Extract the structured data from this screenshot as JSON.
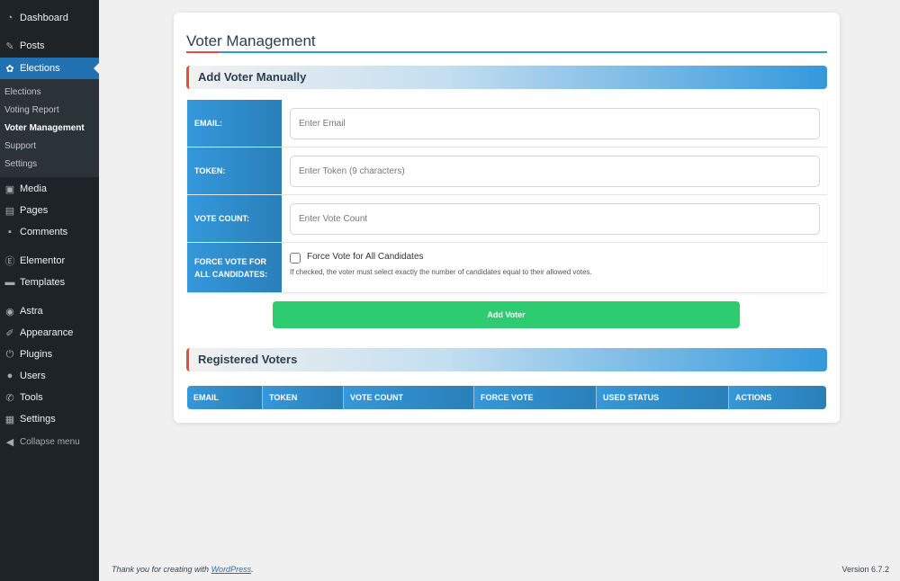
{
  "sidebar": {
    "items": [
      {
        "label": "Dashboard",
        "icon": "dashboard-icon"
      },
      {
        "label": "Posts",
        "icon": "pin-icon"
      },
      {
        "label": "Elections",
        "icon": "group-icon"
      },
      {
        "label": "Media",
        "icon": "media-icon"
      },
      {
        "label": "Pages",
        "icon": "pages-icon"
      },
      {
        "label": "Comments",
        "icon": "comment-icon"
      },
      {
        "label": "Elementor",
        "icon": "elementor-icon"
      },
      {
        "label": "Templates",
        "icon": "folder-icon"
      },
      {
        "label": "Astra",
        "icon": "astra-icon"
      },
      {
        "label": "Appearance",
        "icon": "brush-icon"
      },
      {
        "label": "Plugins",
        "icon": "plug-icon"
      },
      {
        "label": "Users",
        "icon": "user-icon"
      },
      {
        "label": "Tools",
        "icon": "wrench-icon"
      },
      {
        "label": "Settings",
        "icon": "settings-icon"
      }
    ],
    "submenu": [
      "Elections",
      "Voting Report",
      "Voter Management",
      "Support",
      "Settings"
    ],
    "collapse": "Collapse menu"
  },
  "page": {
    "title": "Voter Management"
  },
  "add_section": {
    "title": "Add Voter Manually",
    "email_label": "EMAIL:",
    "email_placeholder": "Enter Email",
    "token_label": "TOKEN:",
    "token_placeholder": "Enter Token (9 characters)",
    "count_label": "VOTE COUNT:",
    "count_placeholder": "Enter Vote Count",
    "force_label": "FORCE VOTE FOR ALL CANDIDATES:",
    "force_checkbox": "Force Vote for All Candidates",
    "force_checked": false,
    "force_hint": "If checked, the voter must select exactly the number of candidates equal to their allowed votes.",
    "button": "Add Voter"
  },
  "voters": {
    "title": "Registered Voters",
    "columns": [
      "EMAIL",
      "TOKEN",
      "VOTE COUNT",
      "FORCE VOTE",
      "USED STATUS",
      "ACTIONS"
    ]
  },
  "footer": {
    "text": "Thank you for creating with ",
    "link": "WordPress",
    "suffix": ".",
    "version": "Version 6.7.2"
  },
  "colors": {
    "accent": "#3498db",
    "button": "#2ecc71",
    "highlight": "#e74c3c",
    "menu_active": "#2271b1"
  }
}
